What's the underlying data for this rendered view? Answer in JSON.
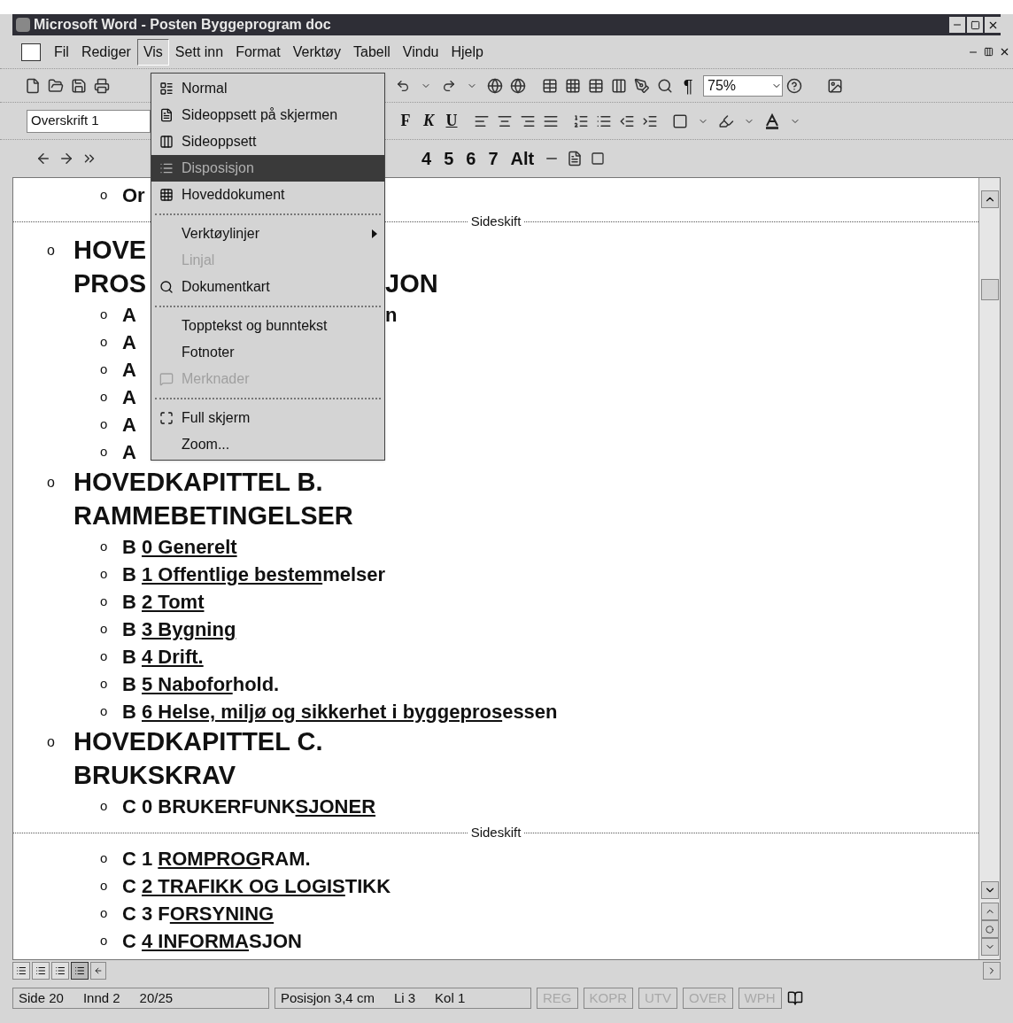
{
  "window": {
    "title": "Microsoft Word - Posten Byggeprogram doc"
  },
  "menu_bar": [
    {
      "label": "Fil",
      "selected": false
    },
    {
      "label": "Rediger",
      "selected": false
    },
    {
      "label": "Vis",
      "selected": true
    },
    {
      "label": "Sett inn",
      "selected": false
    },
    {
      "label": "Format",
      "selected": false
    },
    {
      "label": "Verktøy",
      "selected": false
    },
    {
      "label": "Tabell",
      "selected": false
    },
    {
      "label": "Vindu",
      "selected": false
    },
    {
      "label": "Hjelp",
      "selected": false
    }
  ],
  "toolbar": {
    "zoom": "75%",
    "pilcrow": "¶",
    "style": "Overskrift 1",
    "bold": "F",
    "italic": "K",
    "underline": "U",
    "levels": [
      "4",
      "5",
      "6",
      "7",
      "Alt"
    ]
  },
  "view_menu": [
    {
      "kind": "item",
      "label": "Normal",
      "selected": false,
      "disabled": false
    },
    {
      "kind": "item",
      "label": "Sideoppsett på skjermen",
      "selected": false,
      "disabled": false
    },
    {
      "kind": "item",
      "label": "Sideoppsett",
      "selected": false,
      "disabled": false
    },
    {
      "kind": "item",
      "label": "Disposisjon",
      "selected": true,
      "disabled": false
    },
    {
      "kind": "item",
      "label": "Hoveddokument",
      "selected": false,
      "disabled": false
    },
    {
      "kind": "separator"
    },
    {
      "kind": "submenu",
      "label": "Verktøylinjer",
      "selected": false,
      "disabled": false
    },
    {
      "kind": "item",
      "label": "Linjal",
      "selected": false,
      "disabled": true
    },
    {
      "kind": "item",
      "label": "Dokumentkart",
      "selected": false,
      "disabled": false
    },
    {
      "kind": "separator"
    },
    {
      "kind": "item",
      "label": "Topptekst og bunntekst",
      "selected": false,
      "disabled": false
    },
    {
      "kind": "item",
      "label": "Fotnoter",
      "selected": false,
      "disabled": false
    },
    {
      "kind": "item",
      "label": "Merknader",
      "selected": false,
      "disabled": true
    },
    {
      "kind": "separator"
    },
    {
      "kind": "item",
      "label": "Full skjerm",
      "selected": false,
      "disabled": false
    },
    {
      "kind": "item",
      "label": "Zoom...",
      "selected": false,
      "disabled": false
    }
  ],
  "document": [
    {
      "kind": "item",
      "bullet": "o",
      "segments": [
        {
          "text": "Or",
          "underlined": false
        }
      ]
    },
    {
      "kind": "page_break",
      "label": "Sideskift"
    },
    {
      "kind": "heading",
      "bullet": "o",
      "segments": [
        {
          "text": "HOVE",
          "underlined": false
        }
      ]
    },
    {
      "kind": "heading_cont",
      "segments": [
        {
          "text": "PROS",
          "underlined": false
        }
      ],
      "right": "JON"
    },
    {
      "kind": "item",
      "bullet": "o",
      "segments": [
        {
          "text": "A",
          "underlined": false
        }
      ],
      "right": "n"
    },
    {
      "kind": "item",
      "bullet": "o",
      "segments": [
        {
          "text": "A",
          "underlined": false
        }
      ]
    },
    {
      "kind": "item",
      "bullet": "o",
      "segments": [
        {
          "text": "A",
          "underlined": false
        }
      ]
    },
    {
      "kind": "item",
      "bullet": "o",
      "segments": [
        {
          "text": "A",
          "underlined": false
        }
      ]
    },
    {
      "kind": "item",
      "bullet": "o",
      "segments": [
        {
          "text": "A",
          "underlined": false
        }
      ]
    },
    {
      "kind": "item",
      "bullet": "o",
      "segments": [
        {
          "text": "A",
          "underlined": false
        }
      ]
    },
    {
      "kind": "heading",
      "bullet": "o",
      "segments": [
        {
          "text": "HOVEDKAPITTEL B.",
          "underlined": false
        }
      ]
    },
    {
      "kind": "heading_cont",
      "segments": [
        {
          "text": "RAMMEBETINGELSER",
          "underlined": false
        }
      ]
    },
    {
      "kind": "item",
      "bullet": "o",
      "segments": [
        {
          "text": "B ",
          "underlined": false
        },
        {
          "text": "0 Generelt",
          "underlined": true
        }
      ]
    },
    {
      "kind": "item",
      "bullet": "o",
      "segments": [
        {
          "text": "B ",
          "underlined": false
        },
        {
          "text": "1 Offentlige bestem",
          "underlined": true
        },
        {
          "text": "melser",
          "underlined": false
        }
      ]
    },
    {
      "kind": "item",
      "bullet": "o",
      "segments": [
        {
          "text": "B ",
          "underlined": false
        },
        {
          "text": "2 Tomt",
          "underlined": true
        }
      ]
    },
    {
      "kind": "item",
      "bullet": "o",
      "segments": [
        {
          "text": "B ",
          "underlined": false
        },
        {
          "text": "3 Bygning",
          "underlined": true
        }
      ]
    },
    {
      "kind": "item",
      "bullet": "o",
      "segments": [
        {
          "text": "B ",
          "underlined": false
        },
        {
          "text": "4 Drift.",
          "underlined": true
        }
      ]
    },
    {
      "kind": "item",
      "bullet": "o",
      "segments": [
        {
          "text": "B ",
          "underlined": false
        },
        {
          "text": "5 Nabofor",
          "underlined": true
        },
        {
          "text": "hold.",
          "underlined": false
        }
      ]
    },
    {
      "kind": "item",
      "bullet": "o",
      "segments": [
        {
          "text": "B ",
          "underlined": false
        },
        {
          "text": "6 Helse, miljø og sikkerhet i byggepros",
          "underlined": true
        },
        {
          "text": "essen",
          "underlined": false
        }
      ]
    },
    {
      "kind": "heading",
      "bullet": "o",
      "segments": [
        {
          "text": "HOVEDKAPITTEL C.",
          "underlined": false
        }
      ]
    },
    {
      "kind": "heading_cont",
      "segments": [
        {
          "text": "BRUKSKRAV",
          "underlined": false
        }
      ]
    },
    {
      "kind": "item",
      "bullet": "o",
      "segments": [
        {
          "text": "C 0 BRUKERFUNK",
          "underlined": false
        },
        {
          "text": "SJONER",
          "underlined": true
        }
      ]
    },
    {
      "kind": "page_break",
      "label": "Sideskift"
    },
    {
      "kind": "item",
      "bullet": "o",
      "segments": [
        {
          "text": "C 1 ",
          "underlined": false
        },
        {
          "text": "ROMPROG",
          "underlined": true
        },
        {
          "text": "RAM.",
          "underlined": false
        }
      ]
    },
    {
      "kind": "item",
      "bullet": "o",
      "segments": [
        {
          "text": "C ",
          "underlined": false
        },
        {
          "text": "2 TRAFIKK OG LOGIS",
          "underlined": true
        },
        {
          "text": "TIKK",
          "underlined": false
        }
      ]
    },
    {
      "kind": "item",
      "bullet": "o",
      "segments": [
        {
          "text": "C 3 F",
          "underlined": false
        },
        {
          "text": "ORSYNING",
          "underlined": true
        }
      ]
    },
    {
      "kind": "item",
      "bullet": "o",
      "segments": [
        {
          "text": "C ",
          "underlined": false
        },
        {
          "text": "4 INFORMA",
          "underlined": true
        },
        {
          "text": "SJON",
          "underlined": false
        }
      ]
    }
  ],
  "view_buttons": [
    {
      "selected": false
    },
    {
      "selected": false
    },
    {
      "selected": false
    },
    {
      "selected": true
    }
  ],
  "status_bar": [
    {
      "fields": [
        {
          "text": "Side 20",
          "disabled": false
        },
        {
          "text": "Innd 2",
          "disabled": false
        },
        {
          "text": "20/25",
          "disabled": false
        }
      ]
    },
    {
      "fields": [
        {
          "text": "Posisjon 3,4 cm",
          "disabled": false
        },
        {
          "text": "Li 3",
          "disabled": false
        },
        {
          "text": "Kol 1",
          "disabled": false
        }
      ]
    },
    {
      "fields": [
        {
          "text": "REG",
          "disabled": true
        }
      ]
    },
    {
      "fields": [
        {
          "text": "KOPR",
          "disabled": true
        }
      ]
    },
    {
      "fields": [
        {
          "text": "UTV",
          "disabled": true
        }
      ]
    },
    {
      "fields": [
        {
          "text": "OVER",
          "disabled": true
        }
      ]
    },
    {
      "fields": [
        {
          "text": "WPH",
          "disabled": true
        }
      ]
    }
  ]
}
